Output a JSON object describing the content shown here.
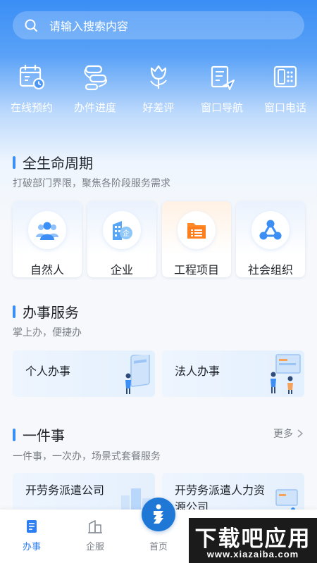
{
  "search": {
    "placeholder": "请输入搜索内容"
  },
  "quick_actions": [
    {
      "label": "在线预约",
      "icon": "calendar-clock-icon"
    },
    {
      "label": "办件进度",
      "icon": "progress-flow-icon"
    },
    {
      "label": "好差评",
      "icon": "tulip-icon"
    },
    {
      "label": "窗口导航",
      "icon": "document-send-icon"
    },
    {
      "label": "窗口电话",
      "icon": "telephone-icon"
    }
  ],
  "lifecycle": {
    "title": "全生命周期",
    "subtitle": "打破部门界限，聚焦各阶段服务需求",
    "cards": [
      {
        "label": "自然人",
        "icon": "people-icon"
      },
      {
        "label": "企业",
        "icon": "enterprise-building-icon"
      },
      {
        "label": "工程项目",
        "icon": "project-folder-icon"
      },
      {
        "label": "社会组织",
        "icon": "network-nodes-icon"
      }
    ]
  },
  "services": {
    "title": "办事服务",
    "subtitle": "掌上办，便捷办",
    "cards": [
      {
        "label": "个人办事"
      },
      {
        "label": "法人办事"
      }
    ]
  },
  "one_thing": {
    "title": "一件事",
    "subtitle": "一件事，一次办，场景式套餐服务",
    "more_label": "更多",
    "cards": [
      {
        "label": "开劳务派遣公司"
      },
      {
        "label": "开劳务派遣人力资源公司"
      }
    ]
  },
  "tabbar": {
    "items": [
      {
        "label": "办事",
        "active": true
      },
      {
        "label": "企服",
        "active": false
      },
      {
        "label": "首页",
        "active": false
      }
    ]
  },
  "watermark": {
    "main": "下载吧应用",
    "url": "www.xiazaiba.com"
  },
  "colors": {
    "primary": "#3a8ef5",
    "active_tab": "#2f7ff3",
    "orange": "#ff7d1a"
  }
}
